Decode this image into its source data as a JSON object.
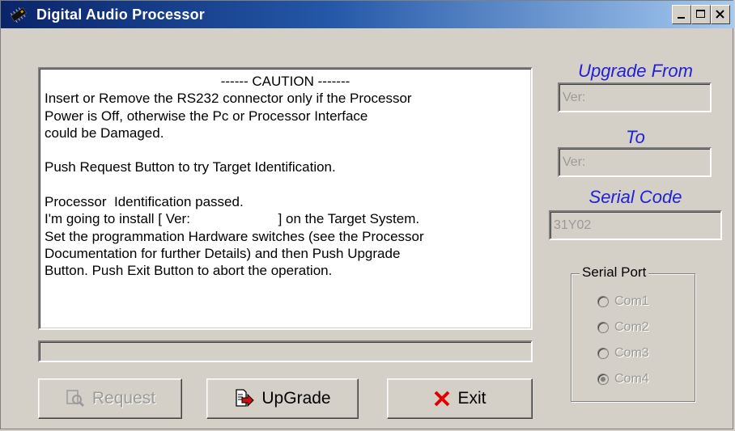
{
  "window": {
    "title": "Digital Audio Processor"
  },
  "message": {
    "lines": [
      "------ CAUTION -------",
      "Insert or Remove the RS232 connector only if the Processor",
      "Power is Off, otherwise the Pc or Processor Interface",
      "could be Damaged.",
      "",
      "Push Request Button to try Target Identification.",
      "",
      "Processor  Identification passed.",
      "I'm going to install [ Ver:                       ] on the Target System.",
      "Set the programmation Hardware switches (see the Processor",
      "Documentation for further Details) and then Push Upgrade",
      "Button. Push Exit Button to abort the operation."
    ]
  },
  "buttons": {
    "request": "Request",
    "upgrade": "UpGrade",
    "exit": "Exit"
  },
  "side": {
    "upgrade_from_label": "Upgrade From",
    "from_value": "Ver:",
    "to_label": "To",
    "to_value": "Ver:",
    "serial_code_label": "Serial Code",
    "serial_code_value": "31Y02"
  },
  "serial_port": {
    "legend": "Serial Port",
    "options": [
      "Com1",
      "Com2",
      "Com3",
      "Com4"
    ],
    "selected": "Com4"
  },
  "colors": {
    "accent_label": "#2020d8",
    "title_bar": "#0a246a"
  },
  "progress": {
    "value": 0
  }
}
